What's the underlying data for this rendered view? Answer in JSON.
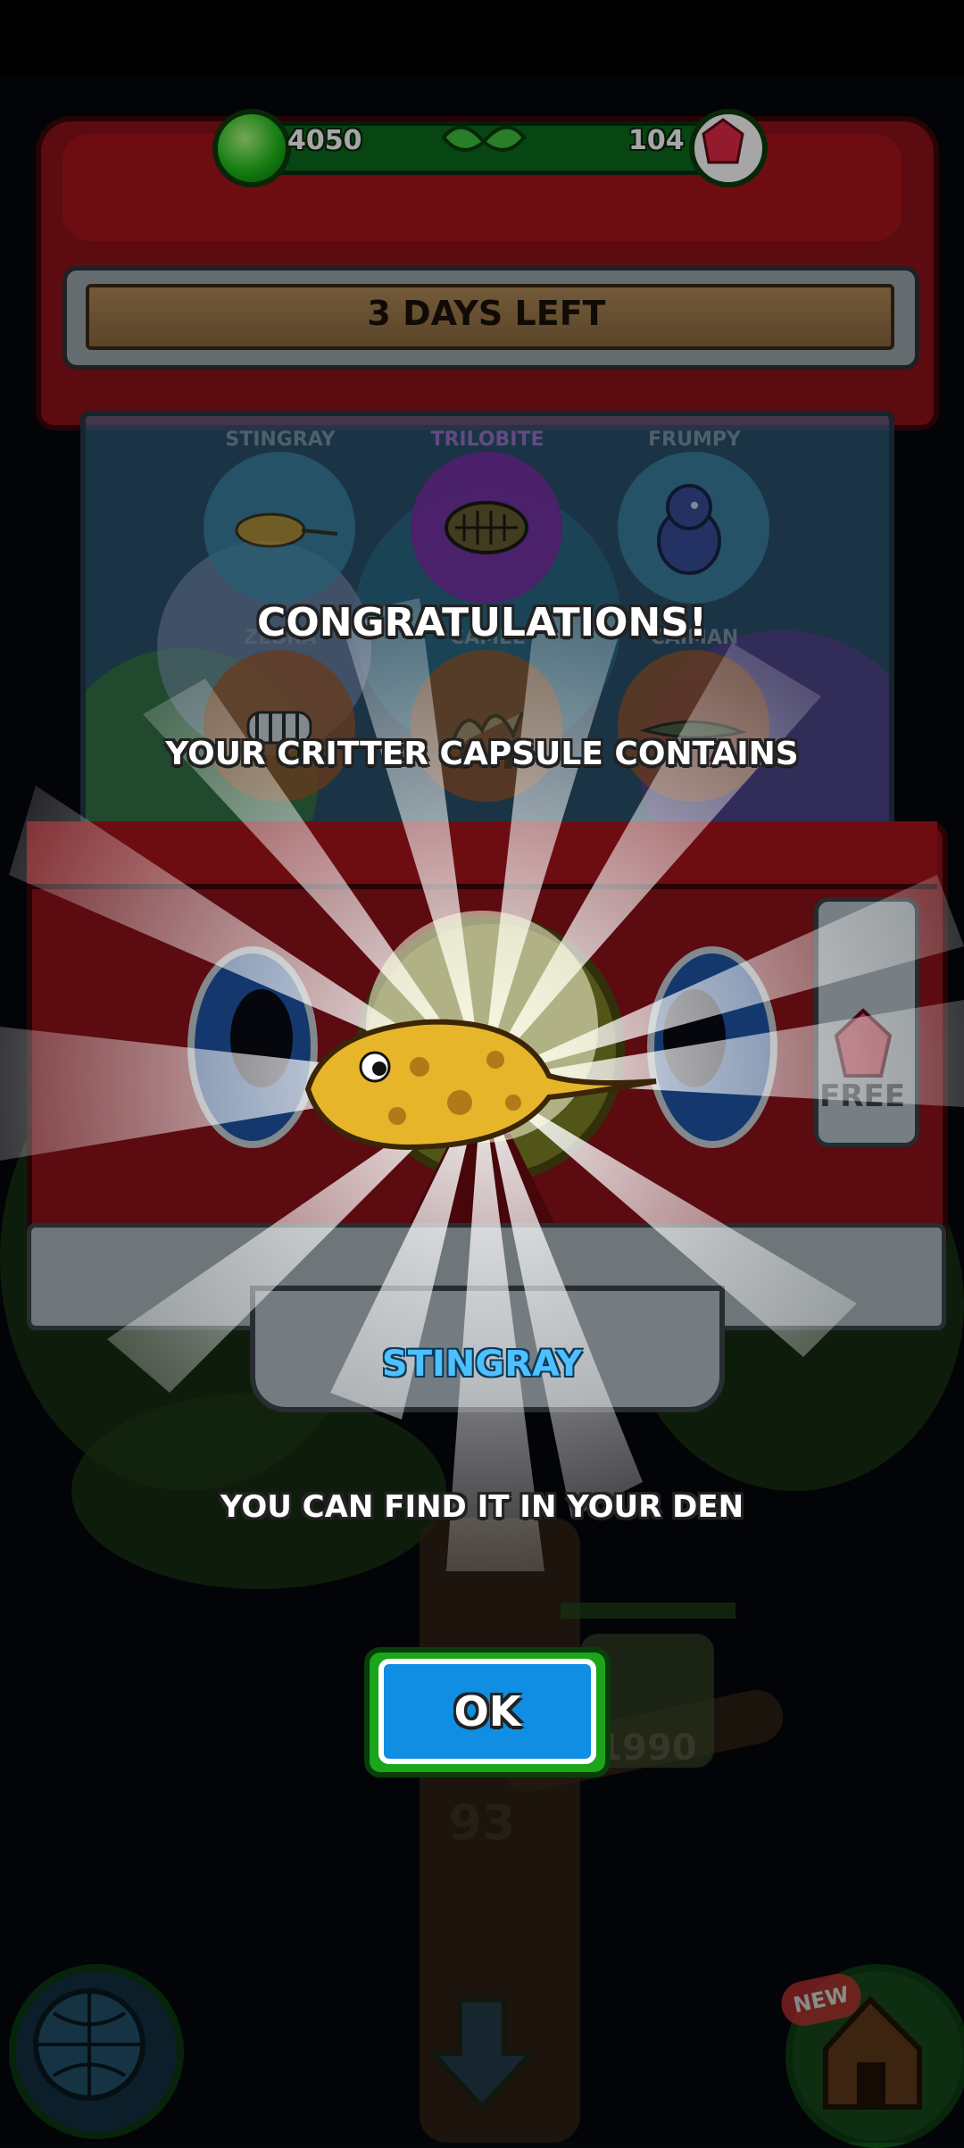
{
  "hud": {
    "gems_green": "4050",
    "gems_red": "104"
  },
  "machine": {
    "banner": "3 DAYS LEFT",
    "free_label": "FREE",
    "slots": [
      {
        "name": "STINGRAY",
        "color": "#3f8fb0"
      },
      {
        "name": "TRILOBITE",
        "color": "#7a2fa8"
      },
      {
        "name": "FRUMPY",
        "color": "#3f8fb0"
      },
      {
        "name": "ZEBRA",
        "color": "#a15a2a"
      },
      {
        "name": "CAMEL",
        "color": "#a15a2a"
      },
      {
        "name": "CAIMAN",
        "color": "#a15a2a"
      }
    ]
  },
  "popup": {
    "title": "CONGRATULATIONS!",
    "subtitle": "YOUR CRITTER CAPSULE CONTAINS",
    "critter_name": "STINGRAY",
    "message": "YOU CAN FIND IT IN YOUR DEN",
    "ok_label": "OK"
  },
  "background": {
    "item_price": "1990",
    "tree_level": "93",
    "new_badge": "NEW"
  },
  "colors": {
    "accent_green": "#1aa51a",
    "button_blue": "#0f8ee3",
    "critter_name_blue": "#4fc0ff",
    "machine_red": "#8e1119"
  }
}
